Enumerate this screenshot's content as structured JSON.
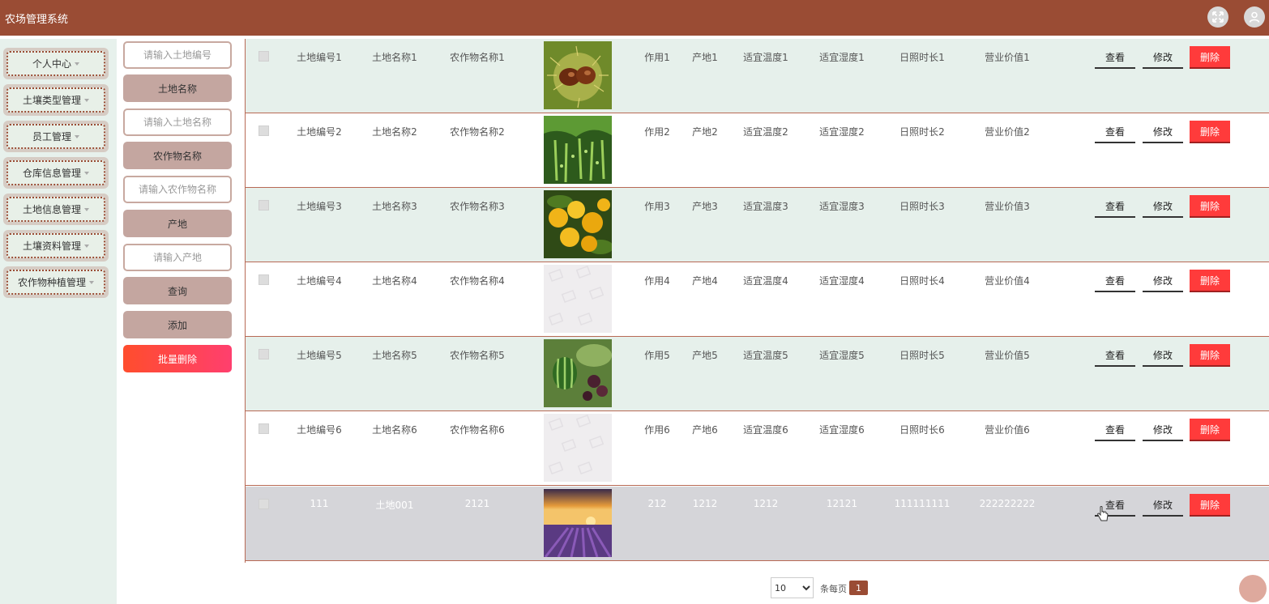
{
  "app": {
    "title": "农场管理系统"
  },
  "header": {
    "fullscreen_icon": "fullscreen-icon",
    "user_icon": "user-icon"
  },
  "colors": {
    "brand": "#9a4c34",
    "sidebar_bg": "#e7f1ec",
    "danger": "#ff3b3b",
    "row_alt": "#e6f0eb",
    "row_selected": "#d5d5d9"
  },
  "sidebar": {
    "items": [
      {
        "label": "个人中心"
      },
      {
        "label": "土壤类型管理"
      },
      {
        "label": "员工管理"
      },
      {
        "label": "仓库信息管理"
      },
      {
        "label": "土地信息管理"
      },
      {
        "label": "土壤资料管理"
      },
      {
        "label": "农作物种植管理"
      }
    ]
  },
  "search": {
    "land_no_placeholder": "请输入土地编号",
    "land_name_label": "土地名称",
    "land_name_placeholder": "请输入土地名称",
    "crop_name_label": "农作物名称",
    "crop_name_placeholder": "请输入农作物名称",
    "origin_label": "产地",
    "origin_placeholder": "请输入产地",
    "query_button": "查询",
    "add_button": "添加",
    "batch_delete_button": "批量删除"
  },
  "table": {
    "actions": {
      "view": "查看",
      "edit": "修改",
      "delete": "删除"
    },
    "rows": [
      {
        "land_no": "土地编号1",
        "land_name": "土地名称1",
        "crop_name": "农作物名称1",
        "image": "chestnut",
        "use": "作用1",
        "origin": "产地1",
        "temp": "适宜温度1",
        "humidity": "适宜湿度1",
        "sunshine": "日照时长1",
        "value": "营业价值1"
      },
      {
        "land_no": "土地编号2",
        "land_name": "土地名称2",
        "crop_name": "农作物名称2",
        "image": "beans",
        "use": "作用2",
        "origin": "产地2",
        "temp": "适宜温度2",
        "humidity": "适宜湿度2",
        "sunshine": "日照时长2",
        "value": "营业价值2"
      },
      {
        "land_no": "土地编号3",
        "land_name": "土地名称3",
        "crop_name": "农作物名称3",
        "image": "oranges",
        "use": "作用3",
        "origin": "产地3",
        "temp": "适宜温度3",
        "humidity": "适宜湿度3",
        "sunshine": "日照时长3",
        "value": "营业价值3"
      },
      {
        "land_no": "土地编号4",
        "land_name": "土地名称4",
        "crop_name": "农作物名称4",
        "image": "placeholder",
        "use": "作用4",
        "origin": "产地4",
        "temp": "适宜温度4",
        "humidity": "适宜湿度4",
        "sunshine": "日照时长4",
        "value": "营业价值4"
      },
      {
        "land_no": "土地编号5",
        "land_name": "土地名称5",
        "crop_name": "农作物名称5",
        "image": "watermelon",
        "use": "作用5",
        "origin": "产地5",
        "temp": "适宜温度5",
        "humidity": "适宜湿度5",
        "sunshine": "日照时长5",
        "value": "营业价值5"
      },
      {
        "land_no": "土地编号6",
        "land_name": "土地名称6",
        "crop_name": "农作物名称6",
        "image": "placeholder",
        "use": "作用6",
        "origin": "产地6",
        "temp": "适宜温度6",
        "humidity": "适宜湿度6",
        "sunshine": "日照时长6",
        "value": "营业价值6"
      },
      {
        "land_no": "111",
        "land_name": "土地001",
        "crop_name": "2121",
        "image": "lavender",
        "use": "212",
        "origin": "1212",
        "temp": "1212",
        "humidity": "12121",
        "sunshine": "111111111",
        "value": "222222222"
      }
    ]
  },
  "pagination": {
    "page_size": "10",
    "page_size_options": [
      "10"
    ],
    "per_page_label": "条每页",
    "current_page": "1"
  }
}
